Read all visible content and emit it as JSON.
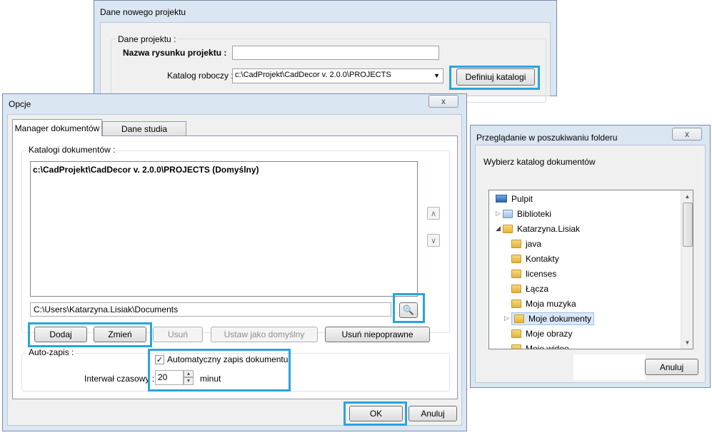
{
  "bg_dialog": {
    "title": "Dane nowego projektu",
    "group_label": "Dane projektu :",
    "name_label": "Nazwa rysunku projektu :",
    "name_value": "",
    "dir_label": "Katalog roboczy :",
    "dir_value": "c:\\CadProjekt\\CadDecor v. 2.0.0\\PROJECTS",
    "define_button": "Definiuj katalogi"
  },
  "options": {
    "title": "Opcje",
    "close": "x",
    "tabs": [
      "Manager dokumentów",
      "Dane studia"
    ],
    "catalogs_label": "Katalogi dokumentów :",
    "catalog_items": [
      "c:\\CadProjekt\\CadDecor v. 2.0.0\\PROJECTS  (Domyślny)"
    ],
    "path_value": "C:\\Users\\Katarzyna.Lisiak\\Documents",
    "buttons": {
      "add": "Dodaj",
      "change": "Zmień",
      "remove": "Usuń",
      "set_default": "Ustaw jako domyślny",
      "remove_invalid": "Usuń niepoprawne"
    },
    "autosave_label": "Auto-zapis :",
    "autosave_checkbox": "Automatyczny zapis dokumentu",
    "autosave_checked": true,
    "interval_label": "Interwał czasowy :",
    "interval_value": "20",
    "interval_unit": "minut",
    "ok": "OK",
    "cancel": "Anuluj"
  },
  "browse": {
    "title": "Przeglądanie w poszukiwaniu folderu",
    "close": "x",
    "instruction": "Wybierz katalog dokumentów",
    "tree": [
      {
        "label": "Pulpit",
        "icon": "desktop-icon"
      },
      {
        "label": "Biblioteki",
        "icon": "library-icon"
      },
      {
        "label": "Katarzyna.Lisiak",
        "icon": "user-folder-icon"
      },
      {
        "label": "java",
        "icon": "folder-icon"
      },
      {
        "label": "Kontakty",
        "icon": "contacts-folder-icon"
      },
      {
        "label": "licenses",
        "icon": "folder-icon"
      },
      {
        "label": "Łącza",
        "icon": "links-folder-icon"
      },
      {
        "label": "Moja muzyka",
        "icon": "music-folder-icon"
      },
      {
        "label": "Moje dokumenty",
        "icon": "documents-folder-icon"
      },
      {
        "label": "Moje obrazy",
        "icon": "pictures-folder-icon"
      },
      {
        "label": "Moje wideo",
        "icon": "video-folder-icon"
      }
    ],
    "cancel": "Anuluj"
  },
  "colors": {
    "highlight": "#2aa4dd",
    "selection": "#d9e8f7"
  }
}
